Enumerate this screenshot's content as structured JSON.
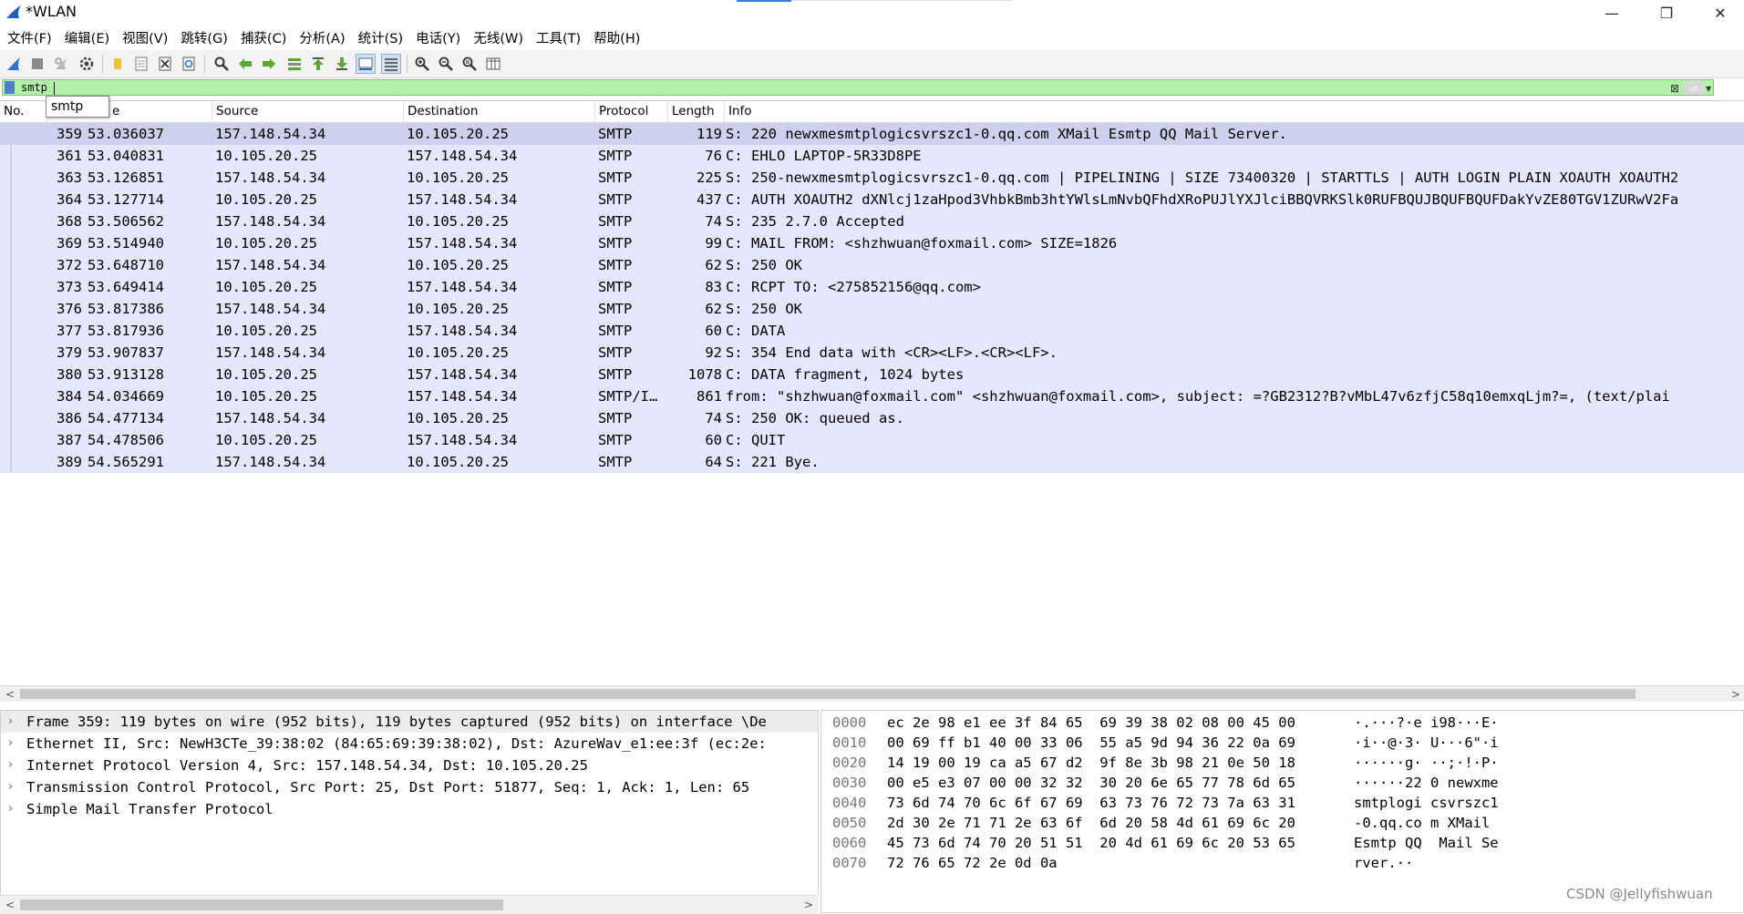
{
  "window": {
    "title": "*WLAN",
    "minimize": "—",
    "restore": "❐",
    "close": "✕"
  },
  "menu": [
    "文件(F)",
    "编辑(E)",
    "视图(V)",
    "跳转(G)",
    "捕获(C)",
    "分析(A)",
    "统计(S)",
    "电话(Y)",
    "无线(W)",
    "工具(T)",
    "帮助(H)"
  ],
  "filter": {
    "value": "smtp",
    "autocomplete": "smtp",
    "clear": "⊠",
    "apply": "⇨",
    "dropdown": "▾",
    "add": "+"
  },
  "columns": {
    "no": "No.",
    "time": "e",
    "source": "Source",
    "destination": "Destination",
    "protocol": "Protocol",
    "length": "Length",
    "info": "Info"
  },
  "packets": [
    {
      "no": "359",
      "time": "53.036037",
      "src": "157.148.54.34",
      "dst": "10.105.20.25",
      "proto": "SMTP",
      "len": "119",
      "info": "S: 220 newxmesmtplogicsvrszc1-0.qq.com XMail Esmtp QQ Mail Server."
    },
    {
      "no": "361",
      "time": "53.040831",
      "src": "10.105.20.25",
      "dst": "157.148.54.34",
      "proto": "SMTP",
      "len": "76",
      "info": "C: EHLO LAPTOP-5R33D8PE"
    },
    {
      "no": "363",
      "time": "53.126851",
      "src": "157.148.54.34",
      "dst": "10.105.20.25",
      "proto": "SMTP",
      "len": "225",
      "info": "S: 250-newxmesmtplogicsvrszc1-0.qq.com | PIPELINING | SIZE 73400320 | STARTTLS | AUTH LOGIN PLAIN XOAUTH XOAUTH2"
    },
    {
      "no": "364",
      "time": "53.127714",
      "src": "10.105.20.25",
      "dst": "157.148.54.34",
      "proto": "SMTP",
      "len": "437",
      "info": "C: AUTH XOAUTH2 dXNlcj1zaHpod3VhbkBmb3htYWlsLmNvbQFhdXRoPUJlYXJlciBBQVRKSlk0RUFBQUJBQUFBQUFDakYvZE80TGV1ZURwV2Fa"
    },
    {
      "no": "368",
      "time": "53.506562",
      "src": "157.148.54.34",
      "dst": "10.105.20.25",
      "proto": "SMTP",
      "len": "74",
      "info": "S: 235 2.7.0 Accepted"
    },
    {
      "no": "369",
      "time": "53.514940",
      "src": "10.105.20.25",
      "dst": "157.148.54.34",
      "proto": "SMTP",
      "len": "99",
      "info": "C: MAIL FROM: <shzhwuan@foxmail.com> SIZE=1826"
    },
    {
      "no": "372",
      "time": "53.648710",
      "src": "157.148.54.34",
      "dst": "10.105.20.25",
      "proto": "SMTP",
      "len": "62",
      "info": "S: 250 OK"
    },
    {
      "no": "373",
      "time": "53.649414",
      "src": "10.105.20.25",
      "dst": "157.148.54.34",
      "proto": "SMTP",
      "len": "83",
      "info": "C: RCPT TO: <275852156@qq.com>"
    },
    {
      "no": "376",
      "time": "53.817386",
      "src": "157.148.54.34",
      "dst": "10.105.20.25",
      "proto": "SMTP",
      "len": "62",
      "info": "S: 250 OK"
    },
    {
      "no": "377",
      "time": "53.817936",
      "src": "10.105.20.25",
      "dst": "157.148.54.34",
      "proto": "SMTP",
      "len": "60",
      "info": "C: DATA"
    },
    {
      "no": "379",
      "time": "53.907837",
      "src": "157.148.54.34",
      "dst": "10.105.20.25",
      "proto": "SMTP",
      "len": "92",
      "info": "S: 354 End data with <CR><LF>.<CR><LF>."
    },
    {
      "no": "380",
      "time": "53.913128",
      "src": "10.105.20.25",
      "dst": "157.148.54.34",
      "proto": "SMTP",
      "len": "1078",
      "info": "C: DATA fragment, 1024 bytes"
    },
    {
      "no": "384",
      "time": "54.034669",
      "src": "10.105.20.25",
      "dst": "157.148.54.34",
      "proto": "SMTP/I…",
      "len": "861",
      "info": "from: \"shzhwuan@foxmail.com\" <shzhwuan@foxmail.com>, subject: =?GB2312?B?vMbL47v6zfjC58q10emxqLjm?=,  (text/plai"
    },
    {
      "no": "386",
      "time": "54.477134",
      "src": "157.148.54.34",
      "dst": "10.105.20.25",
      "proto": "SMTP",
      "len": "74",
      "info": "S: 250 OK: queued as."
    },
    {
      "no": "387",
      "time": "54.478506",
      "src": "10.105.20.25",
      "dst": "157.148.54.34",
      "proto": "SMTP",
      "len": "60",
      "info": "C: QUIT"
    },
    {
      "no": "389",
      "time": "54.565291",
      "src": "157.148.54.34",
      "dst": "10.105.20.25",
      "proto": "SMTP",
      "len": "64",
      "info": "S: 221 Bye."
    }
  ],
  "details": [
    "Frame 359: 119 bytes on wire (952 bits), 119 bytes captured (952 bits) on interface \\De",
    "Ethernet II, Src: NewH3CTe_39:38:02 (84:65:69:39:38:02), Dst: AzureWav_e1:ee:3f (ec:2e:",
    "Internet Protocol Version 4, Src: 157.148.54.34, Dst: 10.105.20.25",
    "Transmission Control Protocol, Src Port: 25, Dst Port: 51877, Seq: 1, Ack: 1, Len: 65",
    "Simple Mail Transfer Protocol"
  ],
  "bytes": [
    {
      "off": "0000",
      "hex": "ec 2e 98 e1 ee 3f 84 65  69 39 38 02 08 00 45 00",
      "ascii": "·.···?·e i98···E·"
    },
    {
      "off": "0010",
      "hex": "00 69 ff b1 40 00 33 06  55 a5 9d 94 36 22 0a 69",
      "ascii": "·i··@·3· U···6\"·i"
    },
    {
      "off": "0020",
      "hex": "14 19 00 19 ca a5 67 d2  9f 8e 3b 98 21 0e 50 18",
      "ascii": "······g· ··;·!·P·"
    },
    {
      "off": "0030",
      "hex": "00 e5 e3 07 00 00 32 32  30 20 6e 65 77 78 6d 65",
      "ascii": "······22 0 newxme"
    },
    {
      "off": "0040",
      "hex": "73 6d 74 70 6c 6f 67 69  63 73 76 72 73 7a 63 31",
      "ascii": "smtplogi csvrszc1"
    },
    {
      "off": "0050",
      "hex": "2d 30 2e 71 71 2e 63 6f  6d 20 58 4d 61 69 6c 20",
      "ascii": "-0.qq.co m XMail "
    },
    {
      "off": "0060",
      "hex": "45 73 6d 74 70 20 51 51  20 4d 61 69 6c 20 53 65",
      "ascii": "Esmtp QQ  Mail Se"
    },
    {
      "off": "0070",
      "hex": "72 76 65 72 2e 0d 0a",
      "ascii": "rver.··"
    }
  ],
  "chevron": "›",
  "watermark": "CSDN @Jellyfishwuan",
  "colors": {
    "filter_valid": "#b1f2a8",
    "smtp_row": "#e7e6ff",
    "selected_row": "#ccd0ec"
  }
}
